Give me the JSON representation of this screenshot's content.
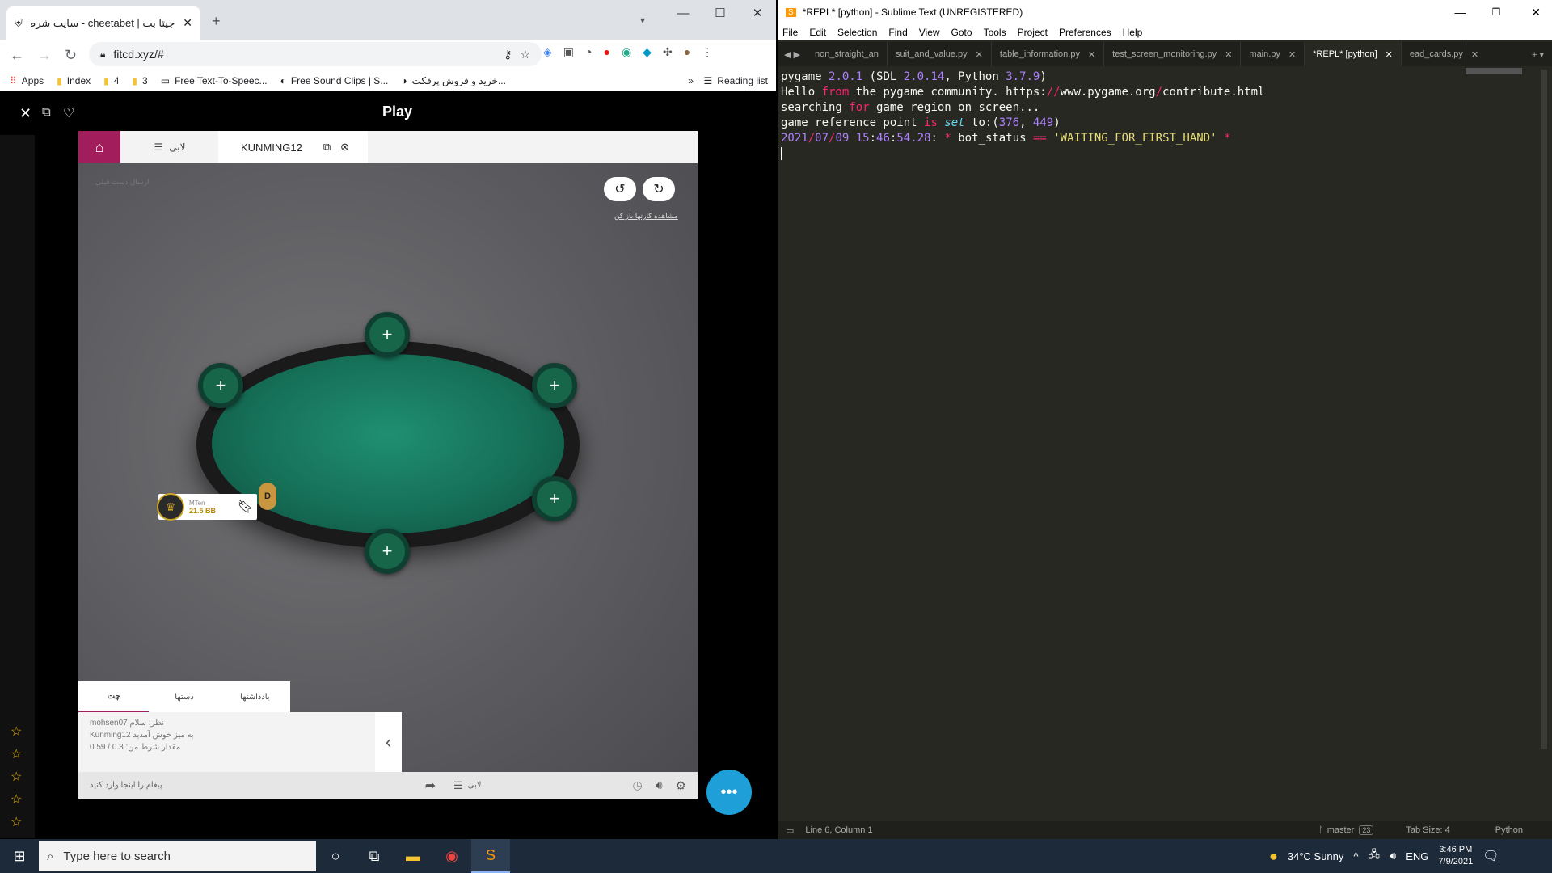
{
  "chrome": {
    "tab_title": "جیتا بت | cheetabet - سایت شرط ب",
    "url": "fitcd.xyz/#",
    "bookmarks": [
      "Apps",
      "Index",
      "4",
      "3",
      "Free Text-To-Speec...",
      "Free Sound Clips | S...",
      "خرید و فروش پرفکت...",
      "Reading list"
    ],
    "minimize": "—",
    "maximize": "☐",
    "close": "✕"
  },
  "play": {
    "title": "Play",
    "tabs": {
      "lobby": "لابی",
      "table": "KUNMING12"
    },
    "show_cards": "مشاهده کارتها باز کن",
    "faint_text": "ارسال دست قبلی",
    "player": {
      "name": "MTen",
      "stack": "21.5 BB"
    },
    "dealer": "D",
    "bottom_tabs": [
      "یادداشتها",
      "دستها",
      "چت"
    ],
    "chat_lines": [
      "mohsen07 نظر: سلام",
      "Kunming12 به میز خوش آمدید",
      "مقدار شرط من: 0.3 / 0.59"
    ],
    "message_placeholder": "پیغام را اینجا وارد کنید",
    "lobby_label": "لابی"
  },
  "sublime": {
    "title": "*REPL* [python] - Sublime Text (UNREGISTERED)",
    "menu": [
      "File",
      "Edit",
      "Selection",
      "Find",
      "View",
      "Goto",
      "Tools",
      "Project",
      "Preferences",
      "Help"
    ],
    "tabs": [
      "non_straight_an",
      "suit_and_value.py",
      "table_information.py",
      "test_screen_monitoring.py",
      "main.py",
      "*REPL* [python]",
      "ead_cards.py"
    ],
    "active_tab": "*REPL* [python]",
    "status": {
      "position": "Line 6, Column 1",
      "branch": "master",
      "branch_count": "23",
      "tab_size": "Tab Size: 4",
      "syntax": "Python"
    }
  },
  "taskbar": {
    "search_placeholder": "Type here to search",
    "weather": "34°C  Sunny",
    "lang": "ENG",
    "time": "3:46 PM",
    "date": "7/9/2021"
  }
}
